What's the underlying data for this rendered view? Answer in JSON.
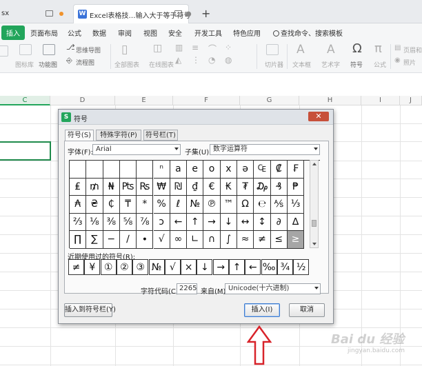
{
  "tabs": {
    "tab1_label": "sx",
    "tab2_logo": "W",
    "tab2_label": "Excel表格技…输入大于等于符号",
    "new_tab": "+"
  },
  "menu": {
    "items": [
      "插入",
      "页面布局",
      "公式",
      "数据",
      "审阅",
      "视图",
      "安全",
      "开发工具",
      "特色应用"
    ],
    "search": "查找命令、搜索模板"
  },
  "ribbon": {
    "labels": [
      "图标库",
      "功能图",
      "思维导图",
      "流程图",
      "全部图表",
      "在线图表",
      "切片器",
      "文本框",
      "艺术字",
      "符号",
      "公式",
      "页眉和",
      "照片"
    ]
  },
  "sheet": {
    "columns": [
      "C",
      "D",
      "E",
      "F",
      "G",
      "H",
      "I",
      "J"
    ]
  },
  "dialog": {
    "title": "符号",
    "tabs": [
      "符号(S)",
      "特殊字符(P)",
      "符号栏(T)"
    ],
    "font_label": "字体(F):",
    "font_value": "Arial",
    "subset_label": "子集(U):",
    "subset_value": "数字运算符",
    "symbols": [
      [
        "",
        "",
        "",
        "ⁿ",
        "a",
        "e",
        "o",
        "x",
        "ə",
        "₠",
        "₡",
        "₣"
      ],
      [
        "₤",
        "₥",
        "₦",
        "₧",
        "₨",
        "₩",
        "₪",
        "₫",
        "€",
        "₭",
        "₮",
        "₯",
        "₰",
        "₱"
      ],
      [
        "₳",
        "₴",
        "₵",
        "₸",
        "*",
        "%",
        "ℓ",
        "№",
        "℗",
        "™",
        "Ω",
        "℮",
        "⅍",
        "⅓"
      ],
      [
        "⅔",
        "⅛",
        "⅜",
        "⅝",
        "⅞",
        "ↄ",
        "←",
        "↑",
        "→",
        "↓",
        "↔",
        "↕",
        "∂",
        "∆"
      ],
      [
        "∏",
        "∑",
        "−",
        "∕",
        "∙",
        "√",
        "∞",
        "∟",
        "∩",
        "∫",
        "≈",
        "≠",
        "≤",
        "≥"
      ]
    ],
    "recent_label": "近期使用过的符号(R):",
    "recent": [
      "≠",
      "¥",
      "①",
      "②",
      "③",
      "№",
      "√",
      "×",
      "↓",
      "→",
      "↑",
      "←",
      "‰",
      "¾",
      "½"
    ],
    "charcode_label": "字符代码(C):",
    "charcode_value": "2265",
    "from_label": "来自(M)",
    "from_value": "Unicode(十六进制)",
    "insert_to_bar": "插入到符号栏(Y)",
    "insert": "插入(I)",
    "cancel": "取消"
  },
  "watermark": {
    "main": "Bai du 经验",
    "sub": "jingyan.baidu.com"
  }
}
